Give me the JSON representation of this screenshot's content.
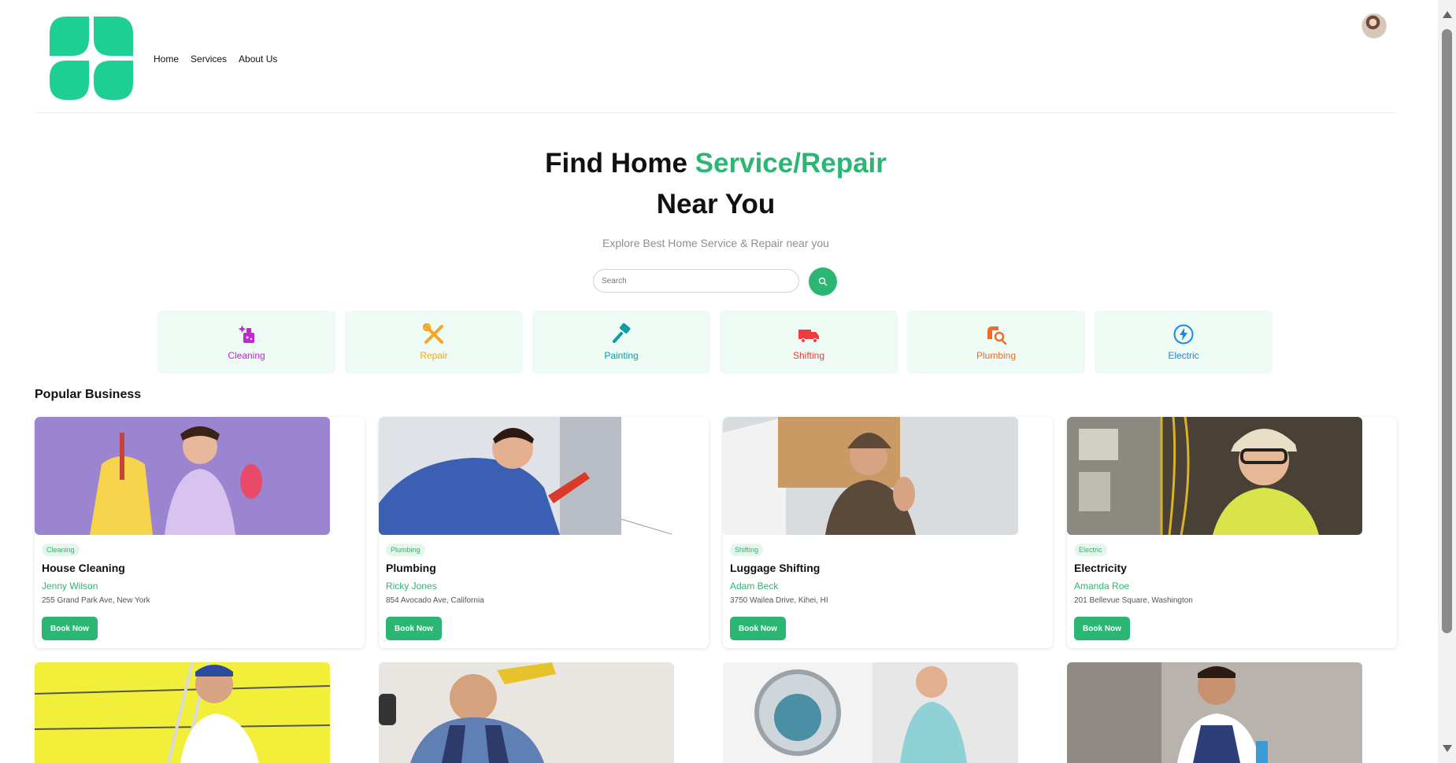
{
  "nav": {
    "items": [
      "Home",
      "Services",
      "About Us"
    ]
  },
  "hero": {
    "title_part1": "Find Home ",
    "title_accent": "Service/Repair",
    "title_line2": "Near You",
    "subtitle": "Explore Best Home Service & Repair near you"
  },
  "search": {
    "placeholder": "Search",
    "value": ""
  },
  "categories": [
    {
      "label": "Cleaning",
      "icon": "cleaning-icon",
      "color": "#c026d3"
    },
    {
      "label": "Repair",
      "icon": "repair-tools-icon",
      "color": "#f5a623"
    },
    {
      "label": "Painting",
      "icon": "paint-brush-icon",
      "color": "#0f9aa6"
    },
    {
      "label": "Shifting",
      "icon": "truck-icon",
      "color": "#ef3b3b"
    },
    {
      "label": "Plumbing",
      "icon": "plumbing-icon",
      "color": "#f06a2a"
    },
    {
      "label": "Electric",
      "icon": "lightning-icon",
      "color": "#1e88e5"
    }
  ],
  "section_title": "Popular Business",
  "businesses": [
    {
      "tag": "Cleaning",
      "title": "House Cleaning",
      "owner": "Jenny Wilson",
      "address": "255 Grand Park Ave, New York",
      "cta": "Book Now"
    },
    {
      "tag": "Plumbing",
      "title": "Plumbing",
      "owner": "Ricky Jones",
      "address": "854 Avocado Ave, California",
      "cta": "Book Now"
    },
    {
      "tag": "Shifting",
      "title": "Luggage Shifting",
      "owner": "Adam Beck",
      "address": "3750 Wailea Drive, Kihei, HI",
      "cta": "Book Now"
    },
    {
      "tag": "Electric",
      "title": "Electricity",
      "owner": "Amanda Roe",
      "address": "201 Bellevue Square, Washington",
      "cta": "Book Now"
    }
  ],
  "colors": {
    "accent": "#2bb673",
    "category_bg": "#eefbf4",
    "tag_bg": "#e2f6ea"
  }
}
